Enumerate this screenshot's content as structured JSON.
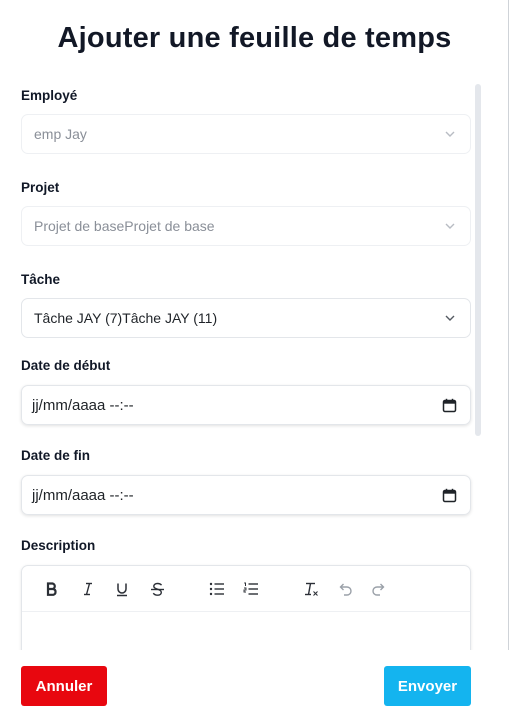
{
  "dialog": {
    "title": "Ajouter une feuille de temps"
  },
  "form": {
    "employee": {
      "label": "Employé",
      "value": "emp Jay"
    },
    "project": {
      "label": "Projet",
      "value": "Projet de baseProjet de base"
    },
    "task": {
      "label": "Tâche",
      "value": "Tâche JAY (7)Tâche JAY (11)"
    },
    "start_date": {
      "label": "Date de début",
      "value": "jj/mm/aaaa --:--"
    },
    "end_date": {
      "label": "Date de fin",
      "value": "jj/mm/aaaa --:--"
    },
    "description": {
      "label": "Description",
      "toolbar": [
        "bold-icon",
        "italic-icon",
        "underline-icon",
        "strikethrough-icon",
        "bullet-list-icon",
        "numbered-list-icon",
        "clear-format-icon",
        "undo-icon",
        "redo-icon"
      ]
    }
  },
  "footer": {
    "cancel_label": "Annuler",
    "submit_label": "Envoyer"
  },
  "colors": {
    "cancel": "#e8070f",
    "submit": "#14b4ef"
  }
}
